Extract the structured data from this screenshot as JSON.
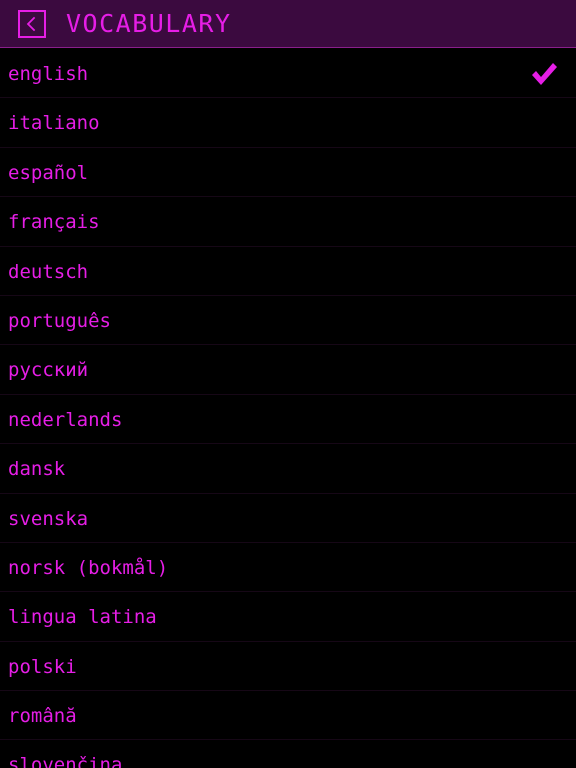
{
  "header": {
    "title": "VOCABULARY",
    "back_icon": "chevron-left-icon"
  },
  "colors": {
    "accent": "#e61ee6",
    "header_bg": "#3b0a3f",
    "background": "#000000"
  },
  "languages": [
    {
      "label": "english",
      "selected": true
    },
    {
      "label": "italiano",
      "selected": false
    },
    {
      "label": "español",
      "selected": false
    },
    {
      "label": "français",
      "selected": false
    },
    {
      "label": "deutsch",
      "selected": false
    },
    {
      "label": "português",
      "selected": false
    },
    {
      "label": "русский",
      "selected": false
    },
    {
      "label": "nederlands",
      "selected": false
    },
    {
      "label": "dansk",
      "selected": false
    },
    {
      "label": "svenska",
      "selected": false
    },
    {
      "label": "norsk (bokmål)",
      "selected": false
    },
    {
      "label": "lingua latina",
      "selected": false
    },
    {
      "label": "polski",
      "selected": false
    },
    {
      "label": "română",
      "selected": false
    },
    {
      "label": "slovenčina",
      "selected": false
    }
  ]
}
